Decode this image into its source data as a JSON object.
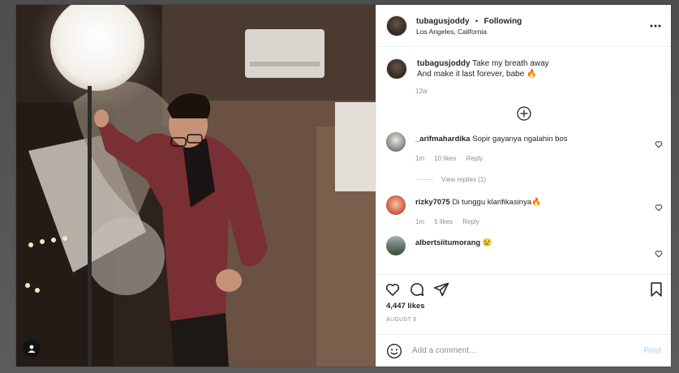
{
  "post": {
    "username": "tubagusjoddy",
    "follow_label": "Following",
    "dot": "•",
    "location": "Los Angeles, California",
    "caption_line1": "Take my breath away",
    "caption_line2": "And make it last forever, babe 🔥",
    "caption_time": "12w",
    "likes": "4,447 likes",
    "date": "AUGUST 9"
  },
  "comments": [
    {
      "username": "_arifmahardika",
      "text": "Sopir gayanya ngalahin bos",
      "time": "1m",
      "likes": "10 likes",
      "reply_label": "Reply",
      "view_replies": "View replies (1)"
    },
    {
      "username": "rizky7075",
      "text": "Di tunggu klarifikasinya🔥",
      "time": "1m",
      "likes": "5 likes",
      "reply_label": "Reply"
    },
    {
      "username": "albertsiitumorang",
      "text": "😢"
    }
  ],
  "composer": {
    "placeholder": "Add a comment...",
    "post_label": "Post"
  },
  "icons": {
    "more": "more-options-icon",
    "load_more": "plus-circle-icon",
    "like": "heart-icon",
    "comment": "comment-icon",
    "share": "share-icon",
    "save": "bookmark-icon",
    "emoji": "emoji-icon",
    "user_tag": "user-tag-icon"
  },
  "colors": {
    "post_button": "#b2dffc",
    "text": "#262626",
    "muted": "#8e8e8e",
    "border": "#efefef"
  }
}
